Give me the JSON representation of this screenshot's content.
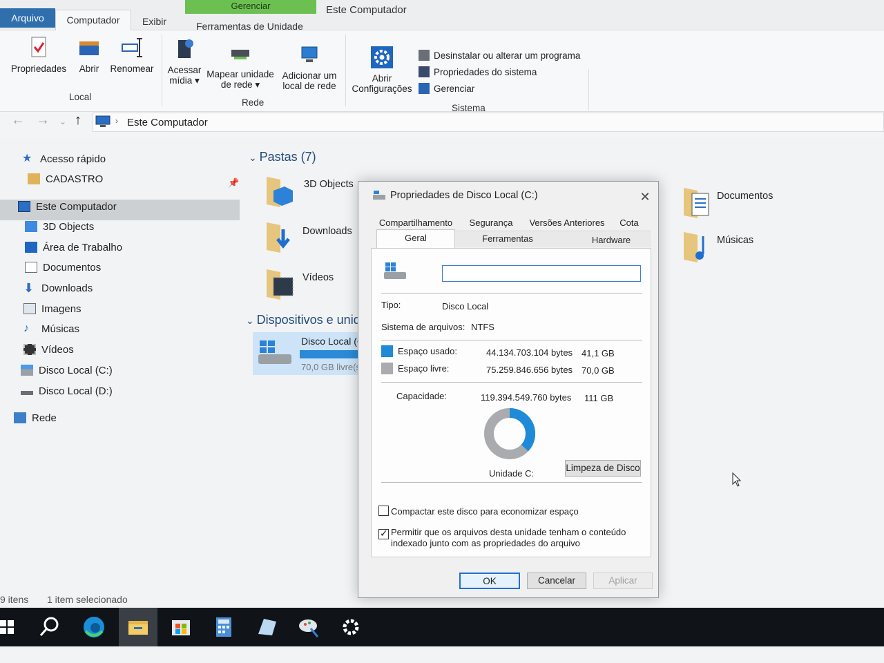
{
  "ribbon": {
    "tabs": {
      "arquivo": "Arquivo",
      "computador": "Computador",
      "exibir": "Exibir",
      "gerenciar": "Gerenciar",
      "ferramentas": "Ferramentas de Unidade"
    },
    "window_title": "Este Computador",
    "local": {
      "propriedades": "Propriedades",
      "abrir": "Abrir",
      "renomear": "Renomear",
      "group": "Local"
    },
    "rede": {
      "acessar1": "Acessar",
      "acessar2": "mídia",
      "mapear1": "Mapear unidade",
      "mapear2": "de rede",
      "adicionar1": "Adicionar um",
      "adicionar2": "local de rede",
      "group": "Rede"
    },
    "sistema": {
      "abrir1": "Abrir",
      "abrir2": "Configurações",
      "desinstalar": "Desinstalar ou alterar um programa",
      "propriedades_sistema": "Propriedades do sistema",
      "gerenciar": "Gerenciar",
      "group": "Sistema"
    }
  },
  "address": {
    "path": "Este Computador"
  },
  "nav": {
    "acesso_rapido": "Acesso rápido",
    "cadastro": "CADASTRO",
    "este_computador": "Este Computador",
    "items": [
      "3D Objects",
      "Área de Trabalho",
      "Documentos",
      "Downloads",
      "Imagens",
      "Músicas",
      "Vídeos",
      "Disco Local (C:)",
      "Disco Local (D:)"
    ],
    "rede": "Rede"
  },
  "content": {
    "pastas_header": "Pastas (7)",
    "folders": {
      "objects": "3D Objects",
      "downloads": "Downloads",
      "videos": "Vídeos",
      "documentos": "Documentos",
      "musicas": "Músicas"
    },
    "devices_header": "Dispositivos e unid",
    "drive_name": "Disco Local (C",
    "drive_free": "70,0 GB livre(s"
  },
  "dialog": {
    "title": "Propriedades de Disco Local (C:)",
    "tabs_row1": [
      "Compartilhamento",
      "Segurança",
      "Versões Anteriores",
      "Cota"
    ],
    "tabs_row2": [
      "Geral",
      "Ferramentas",
      "Hardware"
    ],
    "name_value": "",
    "tipo_label": "Tipo:",
    "tipo_value": "Disco Local",
    "fs_label": "Sistema de arquivos:",
    "fs_value": "NTFS",
    "used_label": "Espaço usado:",
    "used_bytes": "44.134.703.104 bytes",
    "used_gb": "41,1 GB",
    "free_label": "Espaço livre:",
    "free_bytes": "75.259.846.656 bytes",
    "free_gb": "70,0 GB",
    "cap_label": "Capacidade:",
    "cap_bytes": "119.394.549.760 bytes",
    "cap_gb": "111 GB",
    "used_fraction": 0.37,
    "drive_label": "Unidade C:",
    "cleanup": "Limpeza de Disco",
    "compress": "Compactar este disco para economizar espaço",
    "index1": "Permitir que os arquivos desta unidade tenham o conteúdo",
    "index2": "indexado junto com as propriedades do arquivo",
    "ok": "OK",
    "cancel": "Cancelar",
    "apply": "Aplicar",
    "colors": {
      "used": "#1f8ad8",
      "free": "#a9abaf"
    }
  },
  "status": {
    "count": "9 itens",
    "selected": "1 item selecionado"
  },
  "taskbar": {
    "icons": [
      "start-icon",
      "search-icon",
      "edge-icon",
      "file-explorer-icon",
      "store-icon",
      "calculator-icon",
      "notes-icon",
      "paint-icon",
      "settings-icon"
    ]
  }
}
